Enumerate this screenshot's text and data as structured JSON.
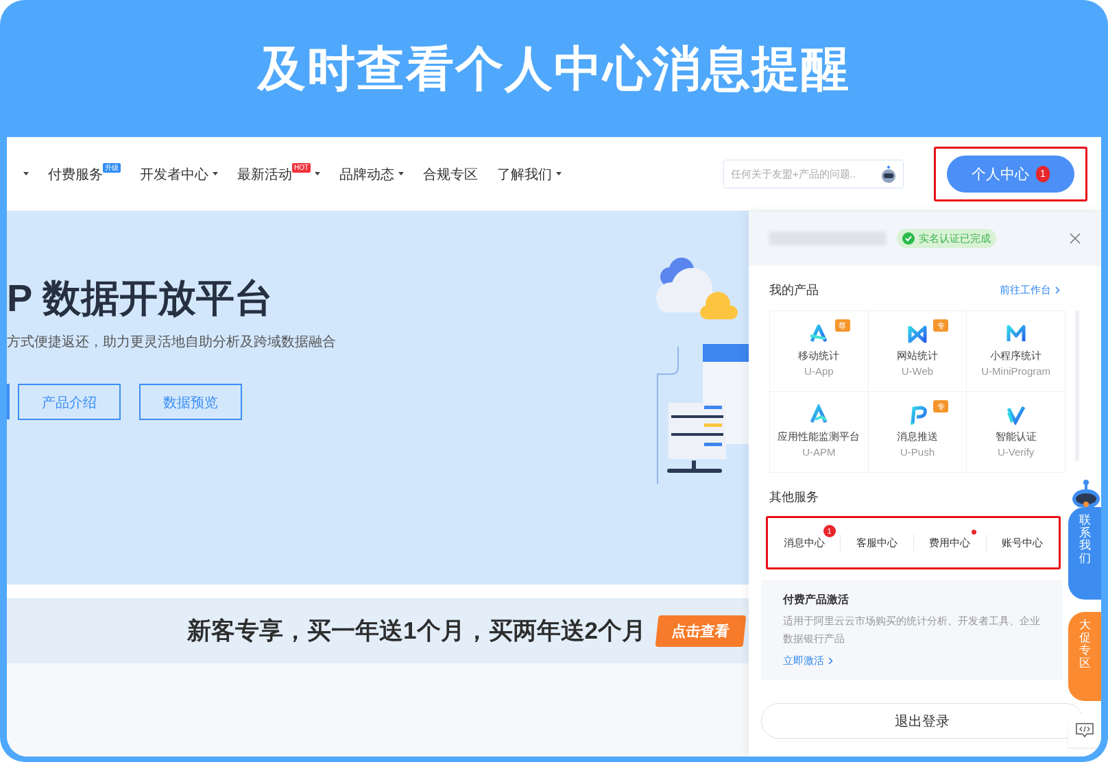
{
  "banner_title": "及时查看个人中心消息提醒",
  "nav": {
    "leading_caret": true,
    "items": [
      {
        "label": "付费服务",
        "dropdown": false,
        "badge": "升级",
        "color": "#2f8cf4"
      },
      {
        "label": "开发者中心",
        "dropdown": true
      },
      {
        "label": "最新活动",
        "dropdown": true,
        "badge": "HOT",
        "color": "#f0323c"
      },
      {
        "label": "品牌动态",
        "dropdown": true
      },
      {
        "label": "合规专区",
        "dropdown": false
      },
      {
        "label": "了解我们",
        "dropdown": true
      }
    ],
    "search": {
      "placeholder": "任何关于友盟+产品的问题.."
    },
    "personal_center": {
      "label": "个人中心",
      "badge": "1",
      "highlighted": true
    }
  },
  "hero": {
    "title": "P 数据开放平台",
    "subtitle": "方式便捷返还，助力更灵活地自助分析及跨域数据融合",
    "buttons": [
      "产品介绍",
      "数据预览"
    ]
  },
  "promo": {
    "text": "新客专享，买一年送1个月，买两年送2个月",
    "button": "点击查看"
  },
  "panel": {
    "verified": "实名认证已完成",
    "my_products": {
      "title": "我的产品",
      "link": "前往工作台",
      "products": [
        {
          "name": "移动统计",
          "code": "U-App",
          "tag": "尊",
          "kind": "a"
        },
        {
          "name": "网站统计",
          "code": "U-Web",
          "tag": "专",
          "kind": "w"
        },
        {
          "name": "小程序统计",
          "code": "U-MiniProgram",
          "kind": "m"
        },
        {
          "name": "应用性能监测平台",
          "code": "U-APM",
          "kind": "apm"
        },
        {
          "name": "消息推送",
          "code": "U-Push",
          "tag": "专",
          "kind": "p"
        },
        {
          "name": "智能认证",
          "code": "U-Verify",
          "kind": "v"
        }
      ]
    },
    "other_services": {
      "title": "其他服务",
      "highlighted": true,
      "items": [
        {
          "label": "消息中心",
          "badge": "1",
          "dot": false
        },
        {
          "label": "客服中心",
          "dot": false
        },
        {
          "label": "费用中心",
          "dot": true
        },
        {
          "label": "账号中心",
          "dot": false
        }
      ]
    },
    "activation": {
      "title": "付费产品激活",
      "description": "适用于阿里云云市场购买的统计分析、开发者工具、企业数据银行产品",
      "link": "立即激活"
    },
    "logout": "退出登录"
  },
  "side_tabs": [
    {
      "label": "联系我们",
      "kind": "contact"
    },
    {
      "label": "大促专区",
      "kind": "promo"
    }
  ]
}
